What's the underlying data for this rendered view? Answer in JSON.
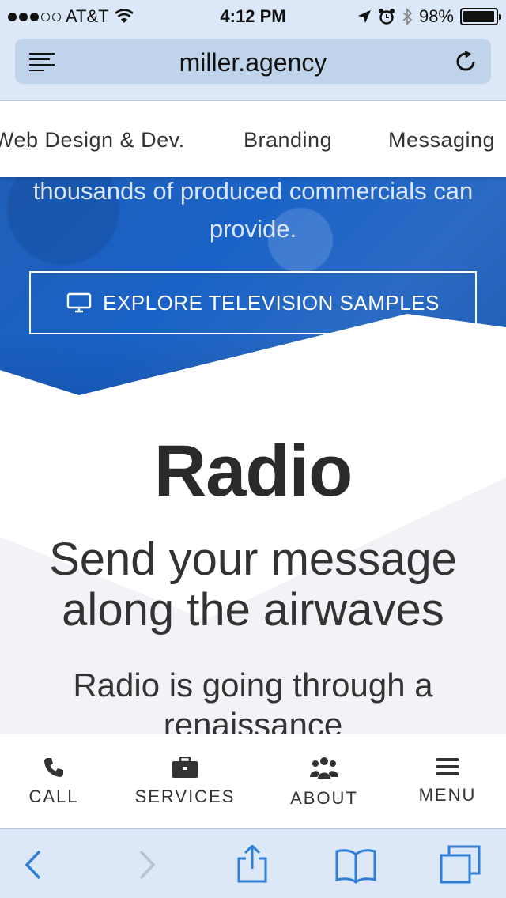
{
  "status_bar": {
    "carrier": "AT&T",
    "time": "4:12 PM",
    "battery": "98%",
    "battery_level": 0.98,
    "signal_bars": 3
  },
  "browser": {
    "url": "miller.agency"
  },
  "subnav": {
    "items": [
      "Web Design & Dev.",
      "Branding",
      "Messaging"
    ]
  },
  "hero": {
    "text_line1": "thousands of produced commercials can",
    "text_line2": "provide.",
    "tv_button_label": "EXPLORE TELEVISION SAMPLES"
  },
  "radio": {
    "title": "Radio",
    "subtitle_line1": "Send your message",
    "subtitle_line2": "along the airwaves",
    "body_line1": "Radio is going through a",
    "body_line2": "renaissance"
  },
  "bottom_nav": {
    "call": "CALL",
    "services": "SERVICES",
    "about": "ABOUT",
    "menu": "MENU"
  },
  "colors": {
    "accent": "#2f7fd8",
    "hero_blue": "#1a62c6",
    "chrome": "#dce8f7"
  }
}
